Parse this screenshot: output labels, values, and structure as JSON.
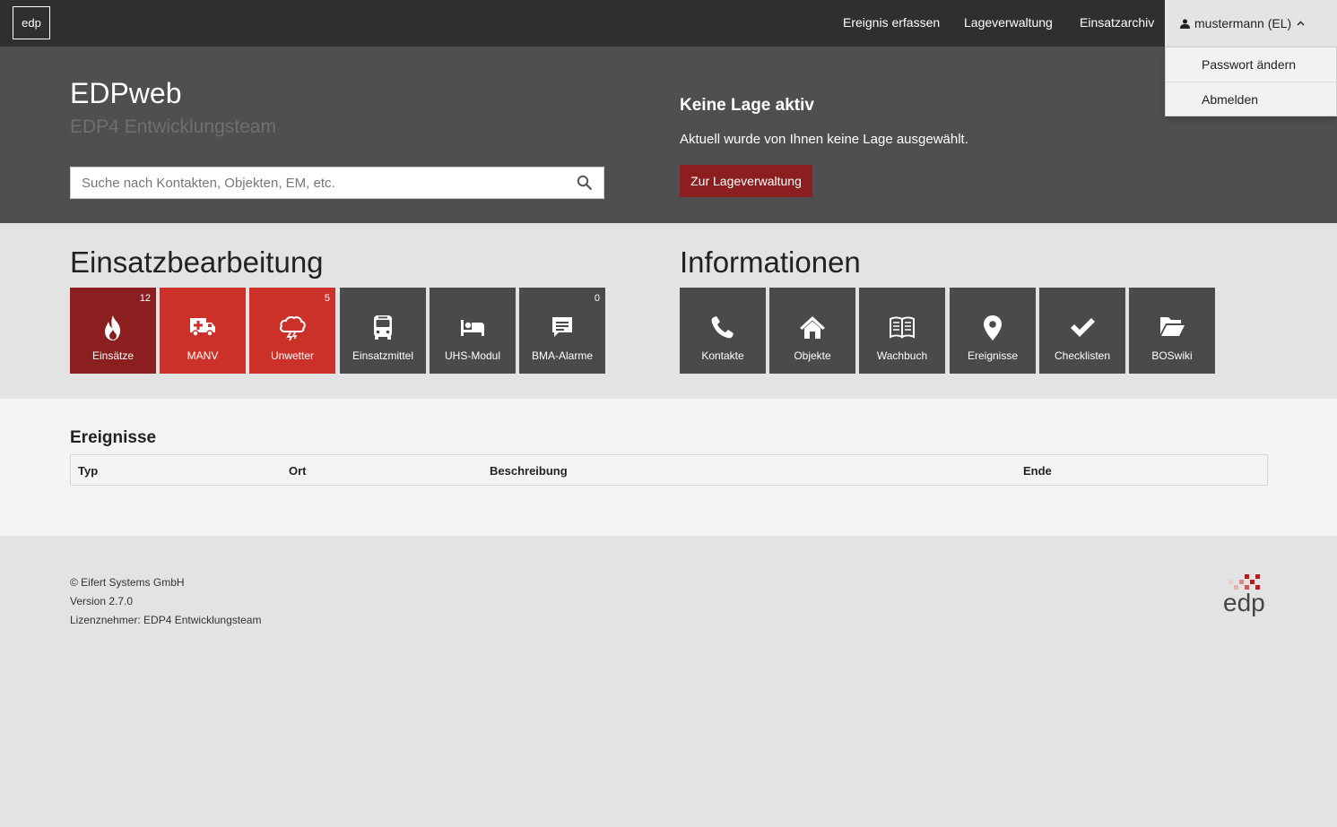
{
  "navbar": {
    "brand": "edp",
    "links": [
      "Ereignis erfassen",
      "Lageverwaltung",
      "Einsatzarchiv"
    ],
    "user": "mustermann (EL)",
    "dropdown": [
      "Passwort ändern",
      "Abmelden"
    ]
  },
  "hero": {
    "title": "EDPweb",
    "subtitle": "EDP4 Entwicklungsteam",
    "search_placeholder": "Suche nach Kontakten, Objekten, EM, etc.",
    "lage_title": "Keine Lage aktiv",
    "lage_text": "Aktuell wurde von Ihnen keine Lage ausgewählt.",
    "lage_button": "Zur Lageverwaltung"
  },
  "einsatz": {
    "title": "Einsatzbearbeitung",
    "tiles": [
      {
        "label": "Einsätze",
        "badge": "12",
        "icon": "fire-icon",
        "color": "#8b1f1f"
      },
      {
        "label": "MANV",
        "badge": "",
        "icon": "ambulance-icon",
        "color": "#cc3129"
      },
      {
        "label": "Unwetter",
        "badge": "5",
        "icon": "storm-cloud-icon",
        "color": "#cc3129"
      },
      {
        "label": "Einsatzmittel",
        "badge": "",
        "icon": "bus-icon",
        "color": "#4a4a4a"
      },
      {
        "label": "UHS-Modul",
        "badge": "",
        "icon": "bed-icon",
        "color": "#4a4a4a"
      },
      {
        "label": "BMA-Alarme",
        "badge": "0",
        "icon": "comment-icon",
        "color": "#4a4a4a"
      }
    ]
  },
  "info": {
    "title": "Informationen",
    "tiles": [
      {
        "label": "Kontakte",
        "icon": "phone-icon"
      },
      {
        "label": "Objekte",
        "icon": "home-icon"
      },
      {
        "label": "Wachbuch",
        "icon": "book-icon"
      },
      {
        "label": "Ereignisse",
        "icon": "map-marker-icon"
      },
      {
        "label": "Checklisten",
        "icon": "check-icon"
      },
      {
        "label": "BOSwiki",
        "icon": "folder-open-icon"
      }
    ]
  },
  "events": {
    "title": "Ereignisse",
    "columns": [
      "Typ",
      "Ort",
      "Beschreibung",
      "Ende"
    ]
  },
  "footer": {
    "copyright": "© Eifert Systems GmbH",
    "version": "Version 2.7.0",
    "licensee": "Lizenznehmer: EDP4 Entwicklungsteam",
    "logo_text": "edp"
  },
  "colors": {
    "navbar": "#2f2f2f",
    "hero": "#4f4f4f",
    "dark_red": "#8b1f1f",
    "red": "#cc3129",
    "tile_gray": "#4a4a4a"
  }
}
